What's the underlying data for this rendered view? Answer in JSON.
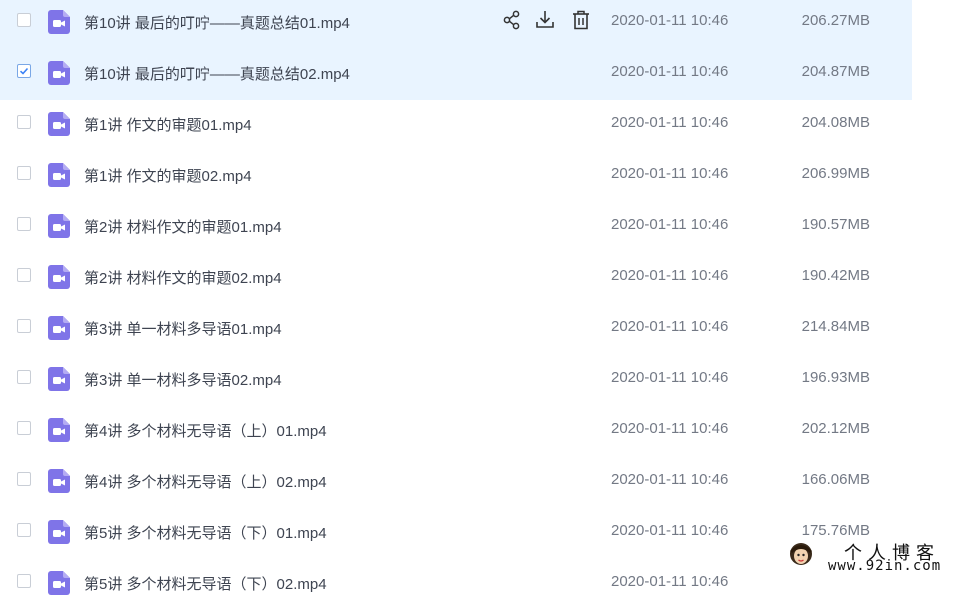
{
  "files": [
    {
      "name": "第10讲 最后的叮咛——真题总结01.mp4",
      "date": "2020-01-11 10:46",
      "size": "206.27MB",
      "checked": false,
      "hover": true
    },
    {
      "name": "第10讲 最后的叮咛——真题总结02.mp4",
      "date": "2020-01-11 10:46",
      "size": "204.87MB",
      "checked": true,
      "hover": false
    },
    {
      "name": "第1讲 作文的审题01.mp4",
      "date": "2020-01-11 10:46",
      "size": "204.08MB",
      "checked": false,
      "hover": false
    },
    {
      "name": "第1讲 作文的审题02.mp4",
      "date": "2020-01-11 10:46",
      "size": "206.99MB",
      "checked": false,
      "hover": false
    },
    {
      "name": "第2讲 材料作文的审题01.mp4",
      "date": "2020-01-11 10:46",
      "size": "190.57MB",
      "checked": false,
      "hover": false
    },
    {
      "name": "第2讲 材料作文的审题02.mp4",
      "date": "2020-01-11 10:46",
      "size": "190.42MB",
      "checked": false,
      "hover": false
    },
    {
      "name": "第3讲 单一材料多导语01.mp4",
      "date": "2020-01-11 10:46",
      "size": "214.84MB",
      "checked": false,
      "hover": false
    },
    {
      "name": "第3讲 单一材料多导语02.mp4",
      "date": "2020-01-11 10:46",
      "size": "196.93MB",
      "checked": false,
      "hover": false
    },
    {
      "name": "第4讲 多个材料无导语（上）01.mp4",
      "date": "2020-01-11 10:46",
      "size": "202.12MB",
      "checked": false,
      "hover": false
    },
    {
      "name": "第4讲 多个材料无导语（上）02.mp4",
      "date": "2020-01-11 10:46",
      "size": "166.06MB",
      "checked": false,
      "hover": false
    },
    {
      "name": "第5讲 多个材料无导语（下）01.mp4",
      "date": "2020-01-11 10:46",
      "size": "175.76MB",
      "checked": false,
      "hover": false
    },
    {
      "name": "第5讲 多个材料无导语（下）02.mp4",
      "date": "2020-01-11 10:46",
      "size": "",
      "checked": false,
      "hover": false
    }
  ],
  "row_actions": {
    "share_icon": "share-icon",
    "download_icon": "download-icon",
    "delete_icon": "delete-icon"
  },
  "file_icon": "video-file-icon",
  "colors": {
    "row_highlight": "#e9f4ff",
    "file_icon": "#7f74e8",
    "checkbox_check": "#3b82f6"
  },
  "watermark": {
    "title": "个人博客",
    "url": "www.92in.com"
  }
}
